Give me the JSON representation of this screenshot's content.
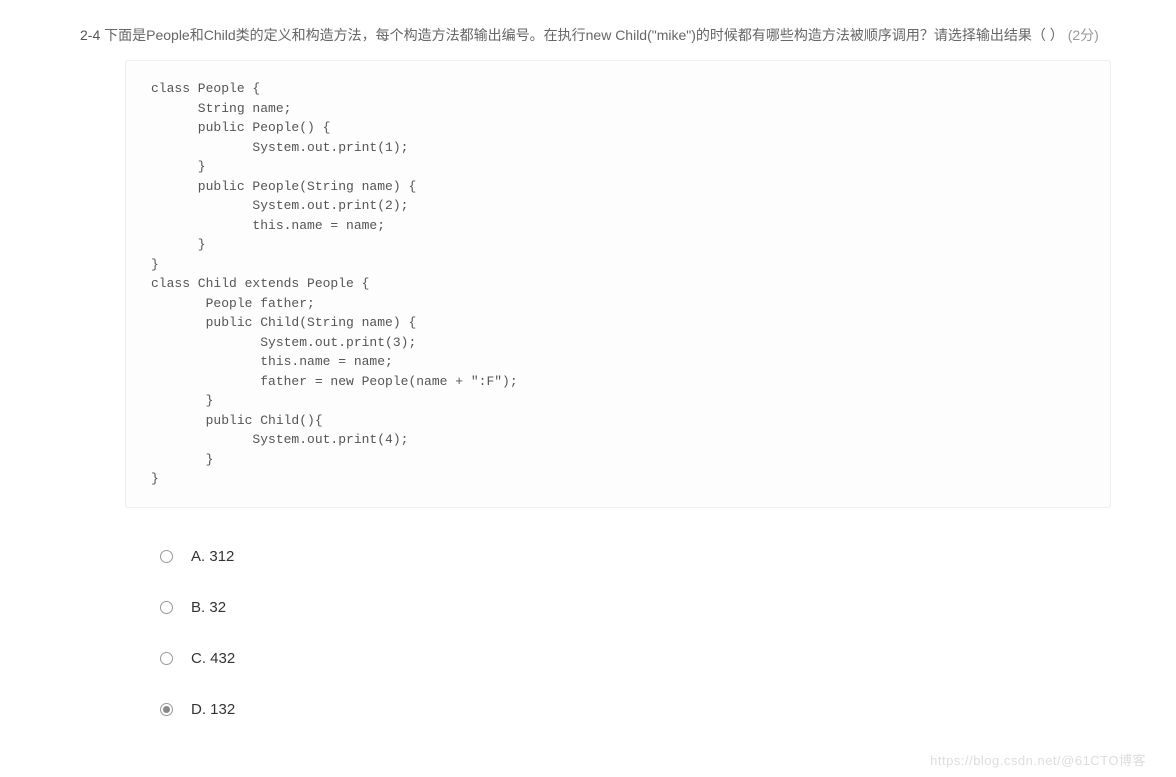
{
  "question": {
    "number": "2-4",
    "text": "下面是People和Child类的定义和构造方法，每个构造方法都输出编号。在执行new Child(\"mike\")的时候都有哪些构造方法被顺序调用？请选择输出结果（  ）",
    "points": "(2分)"
  },
  "code": "class People {\n      String name;\n      public People() {\n             System.out.print(1);\n      }\n      public People(String name) {\n             System.out.print(2);\n             this.name = name;\n      }\n}\nclass Child extends People {\n       People father;\n       public Child(String name) {\n              System.out.print(3);\n              this.name = name;\n              father = new People(name + \":F\");\n       }\n       public Child(){\n             System.out.print(4);\n       }\n}",
  "options": [
    {
      "label": "A.",
      "value": "312",
      "selected": false
    },
    {
      "label": "B.",
      "value": "32",
      "selected": false
    },
    {
      "label": "C.",
      "value": "432",
      "selected": false
    },
    {
      "label": "D.",
      "value": "132",
      "selected": true
    }
  ],
  "watermark": "https://blog.csdn.net/@61CTO博客"
}
